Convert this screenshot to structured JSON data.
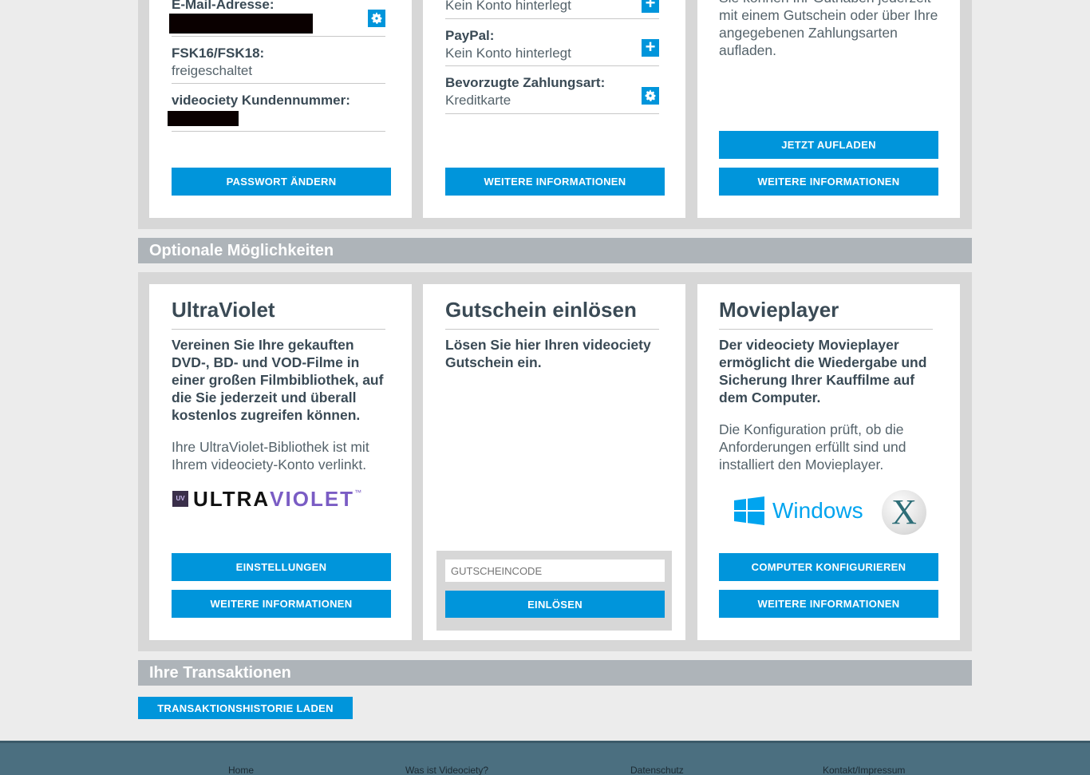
{
  "account": {
    "email_label": "E-Mail-Adresse:",
    "fsk_label": "FSK16/FSK18:",
    "fsk_value": "freigeschaltet",
    "customer_number_label": "videociety Kundennummer:",
    "change_password_button": "PASSWORT ÄNDERN"
  },
  "payment": {
    "credit_card_value": "Kein Konto hinterlegt",
    "paypal_label": "PayPal:",
    "paypal_value": "Kein Konto hinterlegt",
    "preferred_label": "Bevorzugte Zahlungsart:",
    "preferred_value": "Kreditkarte",
    "more_info_button": "WEITERE INFORMATIONEN"
  },
  "balance": {
    "text_partial": "Sie können Ihr Guthaben jederzeit",
    "text": "mit einem Gutschein oder über Ihre angegebenen Zahlungsarten aufladen.",
    "top_up_button": "JETZT AUFLADEN",
    "more_info_button": "WEITERE INFORMATIONEN"
  },
  "optional": {
    "section_title": "Optionale Möglichkeiten",
    "ultraviolet": {
      "title": "UltraViolet",
      "bold_text": "Vereinen Sie Ihre gekauften DVD-, BD- und VOD-Filme in einer großen Filmbibliothek, auf die Sie jederzeit und überall kostenlos zugreifen können.",
      "text": "Ihre UltraViolet-Bibliothek ist mit Ihrem videociety-Konto verlinkt.",
      "logo_text_dark": "ULTRA",
      "logo_text_violet": "VIOLET",
      "logo_badge": "UV",
      "logo_tm": "™",
      "settings_button": "EINSTELLUNGEN",
      "more_info_button": "WEITERE INFORMATIONEN"
    },
    "voucher": {
      "title": "Gutschein einlösen",
      "bold_text": "Lösen Sie hier Ihren videociety Gutschein ein.",
      "input_placeholder": "GUTSCHEINCODE",
      "redeem_button": "EINLÖSEN"
    },
    "movieplayer": {
      "title": "Movieplayer",
      "bold_text": "Der videociety Movieplayer ermöglicht die Wiedergabe und Sicherung Ihrer Kauffilme auf dem Computer.",
      "text": "Die Konfiguration prüft, ob die Anforderungen erfüllt sind und installiert den Movieplayer.",
      "windows_label": "Windows",
      "mac_label": "X",
      "configure_button": "COMPUTER KONFIGURIEREN",
      "more_info_button": "WEITERE INFORMATIONEN"
    }
  },
  "transactions": {
    "section_title": "Ihre Transaktionen",
    "load_history_button": "TRANSAKTIONSHISTORIE LADEN"
  },
  "footer": {
    "links": [
      "Home",
      "Was ist Videociety?",
      "Datenschutz",
      "Kontakt/Impressum"
    ]
  },
  "colors": {
    "accent": "#0095db",
    "section_bar": "#aeb4b9",
    "footer": "#4b6f80",
    "violet": "#7a5cc4"
  }
}
